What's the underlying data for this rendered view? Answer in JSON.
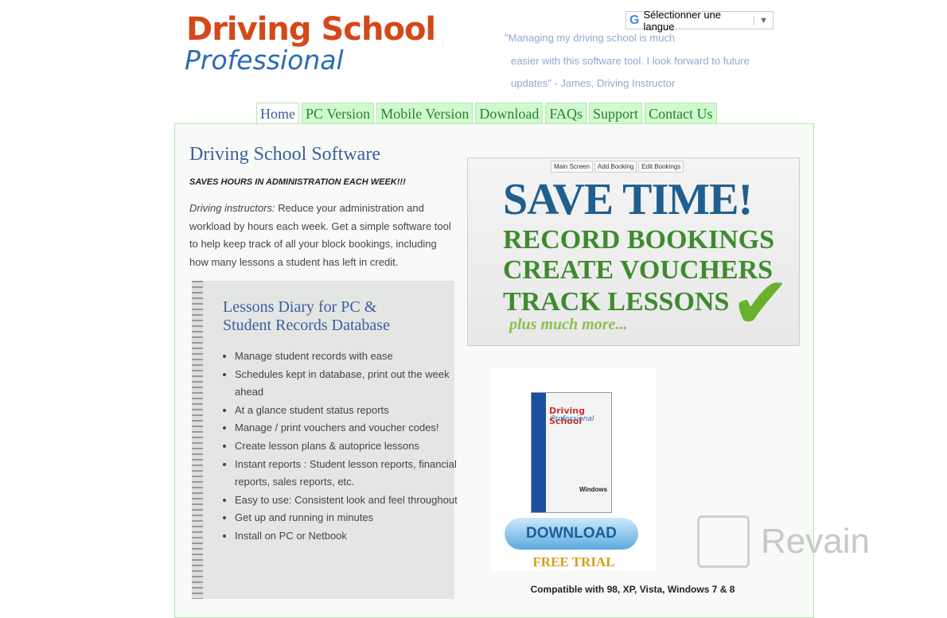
{
  "logo": {
    "line1": "Driving School",
    "line2": "Professional"
  },
  "language": {
    "label": "Sélectionner une langue",
    "icon": "google-icon"
  },
  "quote": [
    "\"Managing my driving school is much",
    "easier with this software tool. I look forward to future",
    "updates\" - James, Driving Instructor"
  ],
  "nav": [
    {
      "label": "Home",
      "active": true
    },
    {
      "label": "PC Version"
    },
    {
      "label": "Mobile Version"
    },
    {
      "label": "Download"
    },
    {
      "label": "FAQs"
    },
    {
      "label": "Support"
    },
    {
      "label": "Contact Us"
    }
  ],
  "main": {
    "title": "Driving School Software",
    "saves": "SAVES HOURS IN ADMINISTRATION EACH WEEK!!!",
    "intro_em": "Driving instructors:",
    "intro": " Reduce your administration and workload by hours each week. Get a simple software tool to help keep track of all your block bookings, including how many lessons a student has left in credit."
  },
  "diary": {
    "title_line1": "Lessons Diary for PC &",
    "title_line2": "Student Records Database",
    "items": [
      "Manage student records with ease",
      "Schedules kept in database, print out the week ahead",
      "At a glance student status reports",
      "Manage / print vouchers and voucher codes!",
      "Create lesson plans & autoprice lessons",
      "Instant reports : Student lesson reports, financial reports, sales reports, etc.",
      "Easy to use: Consistent look and feel throughout",
      "Get up and running in minutes",
      "Install on PC or Netbook"
    ]
  },
  "promo": {
    "tabs": [
      "Main Screen",
      "Add Booking",
      "Edit Bookings"
    ],
    "headline": "SAVE TIME!",
    "lines": [
      "RECORD BOOKINGS",
      "CREATE VOUCHERS",
      "TRACK LESSONS"
    ],
    "more": "plus much more..."
  },
  "product": {
    "box_title": "Driving School",
    "box_sub": "Professional",
    "box_os": "Windows",
    "download": "DOWNLOAD",
    "free_trial": "FREE TRIAL",
    "compat": "Compatible with 98, XP, Vista, Windows 7 & 8"
  },
  "watermark": "Revain"
}
